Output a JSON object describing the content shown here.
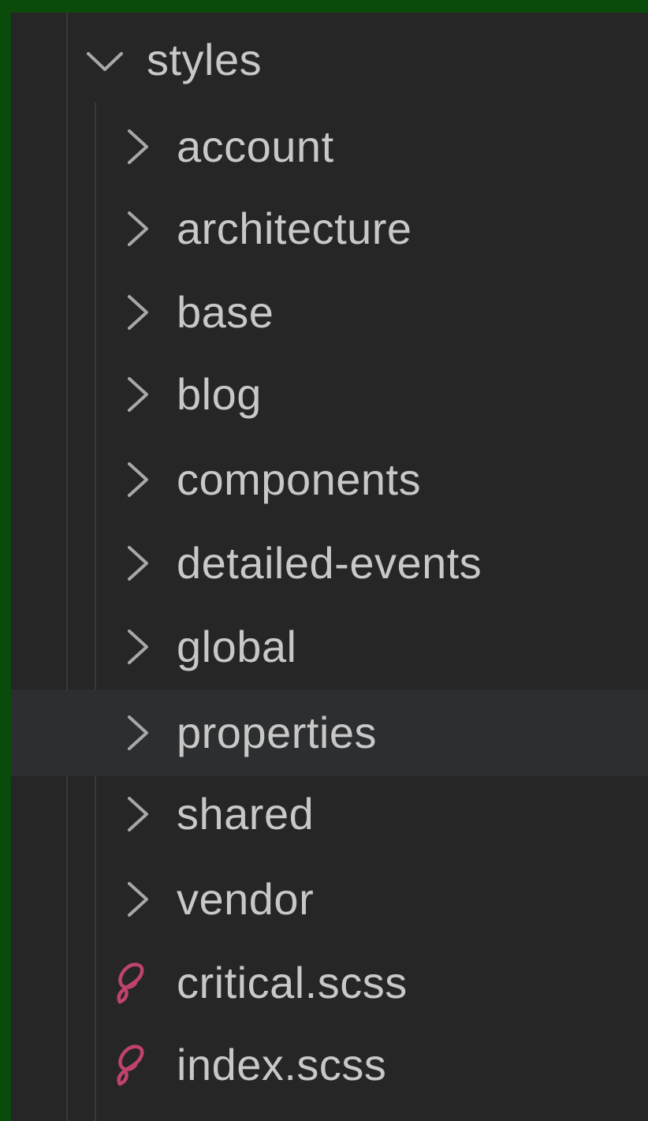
{
  "explorer": {
    "root_folder": {
      "label": "styles",
      "icon": "chevron-down-icon",
      "expanded": true
    },
    "children": [
      {
        "label": "account",
        "type": "folder",
        "icon": "chevron-right-icon"
      },
      {
        "label": "architecture",
        "type": "folder",
        "icon": "chevron-right-icon"
      },
      {
        "label": "base",
        "type": "folder",
        "icon": "chevron-right-icon"
      },
      {
        "label": "blog",
        "type": "folder",
        "icon": "chevron-right-icon"
      },
      {
        "label": "components",
        "type": "folder",
        "icon": "chevron-right-icon"
      },
      {
        "label": "detailed-events",
        "type": "folder",
        "icon": "chevron-right-icon"
      },
      {
        "label": "global",
        "type": "folder",
        "icon": "chevron-right-icon"
      },
      {
        "label": "properties",
        "type": "folder",
        "icon": "chevron-right-icon",
        "hovered": true
      },
      {
        "label": "shared",
        "type": "folder",
        "icon": "chevron-right-icon"
      },
      {
        "label": "vendor",
        "type": "folder",
        "icon": "chevron-right-icon"
      },
      {
        "label": "critical.scss",
        "type": "file",
        "icon": "sass-file-icon"
      },
      {
        "label": "index.scss",
        "type": "file",
        "icon": "sass-file-icon"
      }
    ]
  },
  "colors": {
    "outer_border": "#0a4a0a",
    "panel_background": "#262626",
    "hover_row": "#2c2e30",
    "text": "#c8c8c8",
    "chevron": "#a8a8a8",
    "sass_icon": "#c0436f"
  }
}
